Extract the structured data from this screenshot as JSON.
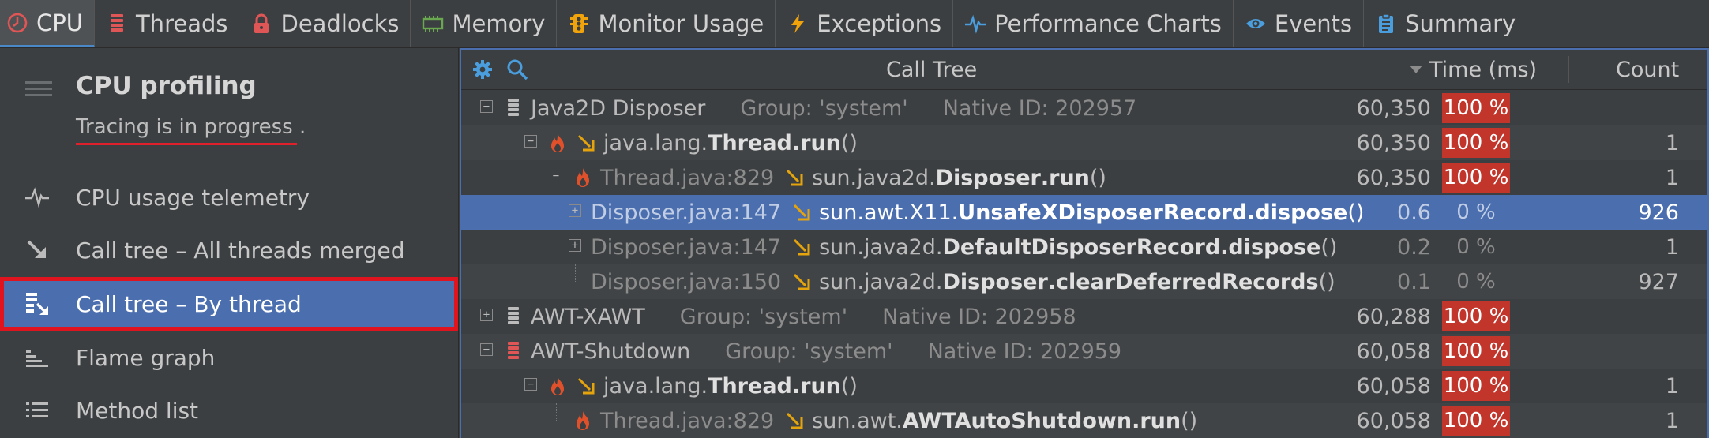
{
  "tabs": [
    {
      "label": "CPU",
      "icon": "clock-icon",
      "color": "#e05555",
      "active": true
    },
    {
      "label": "Threads",
      "icon": "threads-icon",
      "color": "#e05555"
    },
    {
      "label": "Deadlocks",
      "icon": "lock-icon",
      "color": "#e05555"
    },
    {
      "label": "Memory",
      "icon": "memory-chip-icon",
      "color": "#6aa84f"
    },
    {
      "label": "Monitor Usage",
      "icon": "traffic-light-icon",
      "color": "#f0a30a"
    },
    {
      "label": "Exceptions",
      "icon": "lightning-icon",
      "color": "#f0a30a"
    },
    {
      "label": "Performance Charts",
      "icon": "pulse-icon",
      "color": "#4a9ede"
    },
    {
      "label": "Events",
      "icon": "eye-icon",
      "color": "#4a9ede"
    },
    {
      "label": "Summary",
      "icon": "clipboard-icon",
      "color": "#4a9ede"
    }
  ],
  "sidebar": {
    "title": "CPU profiling",
    "status": "Tracing is in progress .",
    "items": [
      {
        "label": "CPU usage telemetry",
        "icon": "pulse-icon"
      },
      {
        "label": "Call tree – All threads merged",
        "icon": "arrow-down-right-icon"
      },
      {
        "label": "Call tree – By thread",
        "icon": "thread-call-tree-icon",
        "selected": true
      },
      {
        "label": "Flame graph",
        "icon": "flame-graph-icon"
      },
      {
        "label": "Method list",
        "icon": "list-icon"
      }
    ]
  },
  "tree": {
    "header": {
      "title": "Call Tree",
      "time": "Time (ms)",
      "count": "Count"
    },
    "rows": [
      {
        "kind": "thread",
        "name": "Java2D Disposer",
        "group": "Group: 'system'",
        "native": "Native ID: 202957",
        "time": "60,350",
        "pct": "100 %",
        "count": ""
      },
      {
        "kind": "method",
        "pkg": "java.lang.",
        "cls": "Thread",
        "meth": ".run",
        "args": "()",
        "time": "60,350",
        "pct": "100 %",
        "count": "1"
      },
      {
        "kind": "method",
        "loc": "Thread.java:829",
        "pkg": "sun.java2d.",
        "cls": "Disposer",
        "meth": ".run",
        "args": "()",
        "time": "60,350",
        "pct": "100 %",
        "count": "1"
      },
      {
        "kind": "method",
        "loc": "Disposer.java:147",
        "pkg": "sun.awt.X11.",
        "cls": "UnsafeXDisposerRecord",
        "meth": ".dispose",
        "args": "()",
        "time": "0.6",
        "pct": "0 %",
        "count": "926",
        "selected": true
      },
      {
        "kind": "method",
        "loc": "Disposer.java:147",
        "pkg": "sun.java2d.",
        "cls": "DefaultDisposerRecord",
        "meth": ".dispose",
        "args": "()",
        "time": "0.2",
        "pct": "0 %",
        "count": "1"
      },
      {
        "kind": "method",
        "loc": "Disposer.java:150",
        "pkg": "sun.java2d.",
        "cls": "Disposer",
        "meth": ".clearDeferredRecords",
        "args": "()",
        "time": "0.1",
        "pct": "0 %",
        "count": "927"
      },
      {
        "kind": "thread",
        "name": "AWT-XAWT",
        "group": "Group: 'system'",
        "native": "Native ID: 202958",
        "time": "60,288",
        "pct": "100 %",
        "count": ""
      },
      {
        "kind": "thread",
        "name": "AWT-Shutdown",
        "group": "Group: 'system'",
        "native": "Native ID: 202959",
        "time": "60,058",
        "pct": "100 %",
        "count": ""
      },
      {
        "kind": "method",
        "pkg": "java.lang.",
        "cls": "Thread",
        "meth": ".run",
        "args": "()",
        "time": "60,058",
        "pct": "100 %",
        "count": "1"
      },
      {
        "kind": "method",
        "loc": "Thread.java:829",
        "pkg": "sun.awt.",
        "cls": "AWTAutoShutdown",
        "meth": ".run",
        "args": "()",
        "time": "60,058",
        "pct": "100 %",
        "count": "1"
      }
    ]
  }
}
